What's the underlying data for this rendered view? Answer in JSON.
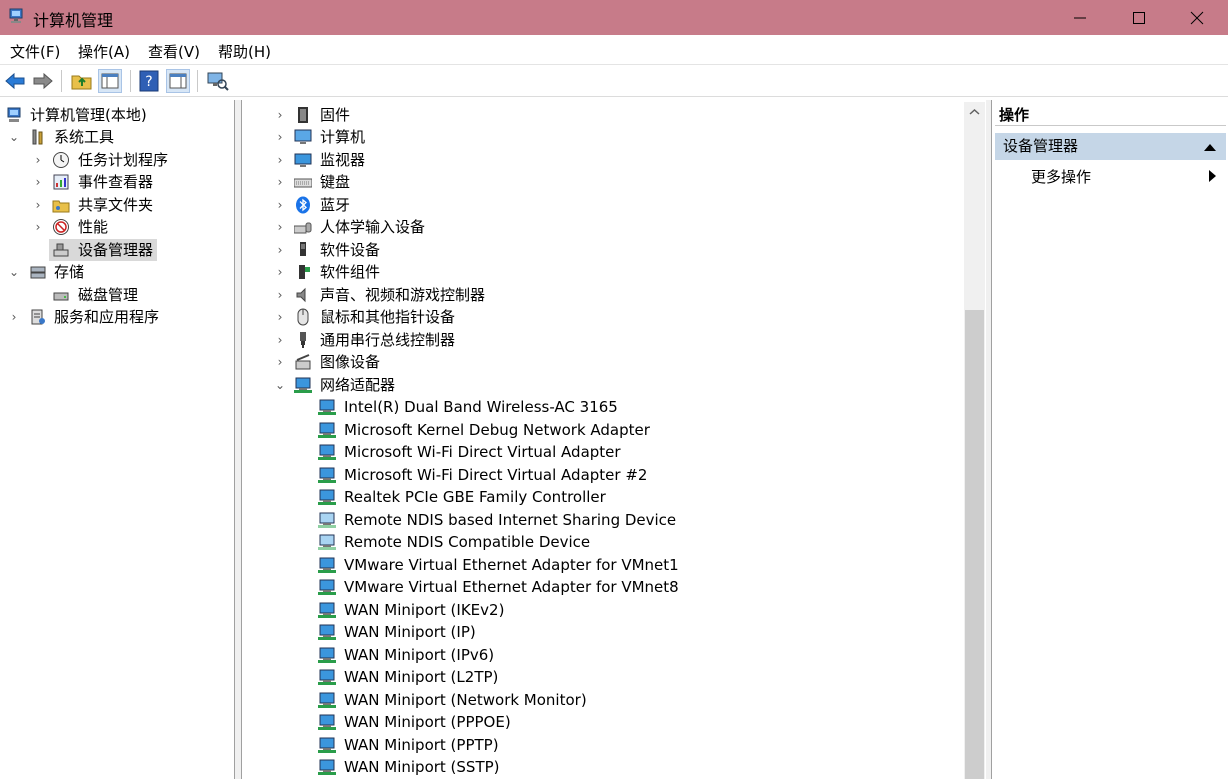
{
  "window": {
    "title": "计算机管理"
  },
  "menu": [
    "文件(F)",
    "操作(A)",
    "查看(V)",
    "帮助(H)"
  ],
  "tree": {
    "root": "计算机管理(本地)",
    "system_tools": "系统工具",
    "task_scheduler": "任务计划程序",
    "event_viewer": "事件查看器",
    "shared_folders": "共享文件夹",
    "performance": "性能",
    "device_manager": "设备管理器",
    "storage": "存储",
    "disk_management": "磁盘管理",
    "services_apps": "服务和应用程序"
  },
  "devices": {
    "categories": [
      "固件",
      "计算机",
      "监视器",
      "键盘",
      "蓝牙",
      "人体学输入设备",
      "软件设备",
      "软件组件",
      "声音、视频和游戏控制器",
      "鼠标和其他指针设备",
      "通用串行总线控制器",
      "图像设备"
    ],
    "network_category": "网络适配器",
    "network_adapters": [
      "Intel(R) Dual Band Wireless-AC 3165",
      "Microsoft Kernel Debug Network Adapter",
      "Microsoft Wi-Fi Direct Virtual Adapter",
      "Microsoft Wi-Fi Direct Virtual Adapter #2",
      "Realtek PCIe GBE Family Controller",
      "Remote NDIS based Internet Sharing Device",
      "Remote NDIS Compatible Device",
      "VMware Virtual Ethernet Adapter for VMnet1",
      "VMware Virtual Ethernet Adapter for VMnet8",
      "WAN Miniport (IKEv2)",
      "WAN Miniport (IP)",
      "WAN Miniport (IPv6)",
      "WAN Miniport (L2TP)",
      "WAN Miniport (Network Monitor)",
      "WAN Miniport (PPPOE)",
      "WAN Miniport (PPTP)",
      "WAN Miniport (SSTP)"
    ]
  },
  "actions": {
    "header": "操作",
    "group": "设备管理器",
    "more": "更多操作"
  },
  "colors": {
    "titlebar": "#c77b89",
    "selection": "#d9d9d9",
    "action_group": "#c5d6e7"
  }
}
